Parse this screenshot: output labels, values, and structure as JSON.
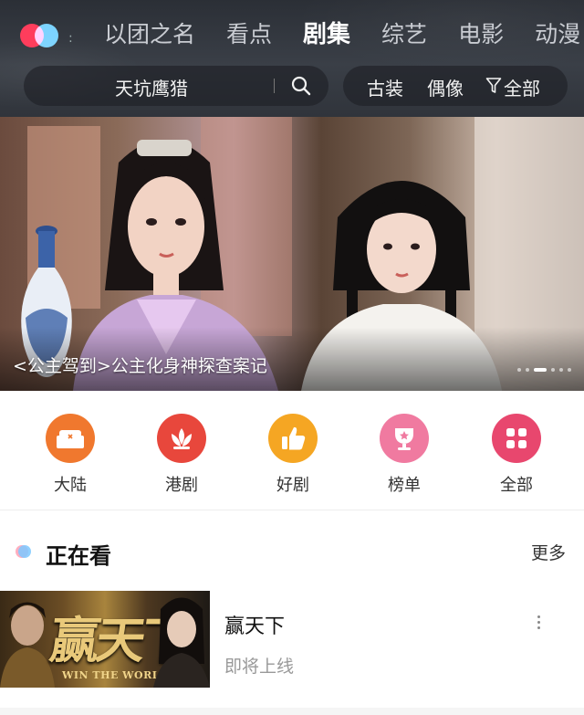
{
  "nav": {
    "tabs": [
      {
        "label": "以团之名"
      },
      {
        "label": "看点"
      },
      {
        "label": "剧集"
      },
      {
        "label": "综艺"
      },
      {
        "label": "电影"
      },
      {
        "label": "动漫"
      }
    ],
    "active_tab": "剧集",
    "separator": ":"
  },
  "search": {
    "query": "天坑鹰猎",
    "icon": "search-icon"
  },
  "filters": {
    "items": [
      "古装",
      "偶像"
    ],
    "all_label": "全部",
    "icon": "filter-icon"
  },
  "banner": {
    "caption": "<公主驾到>公主化身神探查案记",
    "dot_count": 6,
    "active_dot": 2
  },
  "categories": [
    {
      "label": "大陆",
      "icon": "sofa-icon",
      "color": "#f0782e"
    },
    {
      "label": "港剧",
      "icon": "lotus-icon",
      "color": "#e8473c"
    },
    {
      "label": "好剧",
      "icon": "thumbs-up-icon",
      "color": "#f5a623"
    },
    {
      "label": "榜单",
      "icon": "trophy-icon",
      "color": "#f07aa0"
    },
    {
      "label": "全部",
      "icon": "grid-icon",
      "color": "#e8476e"
    }
  ],
  "watching": {
    "title": "正在看",
    "more_label": "更多",
    "items": [
      {
        "title": "赢天下",
        "status": "即将上线",
        "poster_art": "赢天下",
        "poster_subtitle": "WIN THE WORLD"
      }
    ]
  }
}
